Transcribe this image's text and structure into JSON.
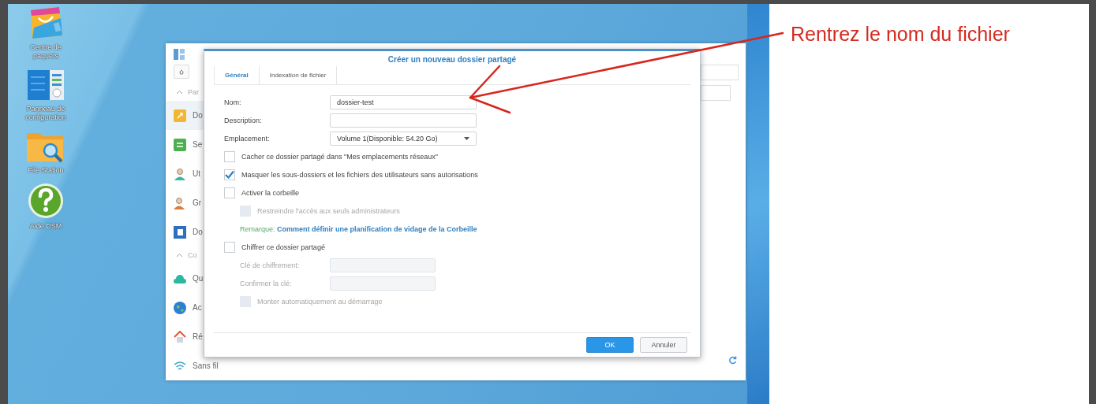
{
  "desktop_icons": [
    {
      "label": "Centre de paquets",
      "kind": "bag"
    },
    {
      "label": "Panneau de configuration",
      "kind": "panel"
    },
    {
      "label": "File Station",
      "kind": "folder"
    },
    {
      "label": "Aide DSM",
      "kind": "help"
    }
  ],
  "background_window": {
    "sidebar_items": [
      {
        "label": "Par",
        "kind": "section",
        "selected": false
      },
      {
        "label": "Do",
        "kind": "share",
        "selected": true
      },
      {
        "label": "Se",
        "kind": "sync",
        "selected": false
      },
      {
        "label": "Ut",
        "kind": "user",
        "selected": false
      },
      {
        "label": "Gr",
        "kind": "group",
        "selected": false
      },
      {
        "label": "Do",
        "kind": "domain",
        "selected": false
      },
      {
        "label": "Co",
        "kind": "section",
        "selected": false
      },
      {
        "label": "Qu",
        "kind": "cloud",
        "selected": false
      },
      {
        "label": "Ac",
        "kind": "globe",
        "selected": false
      },
      {
        "label": "Ré",
        "kind": "house",
        "selected": false
      },
      {
        "label": "Sans fil",
        "kind": "wifi",
        "selected": false
      }
    ]
  },
  "dialog": {
    "title": "Créer un nouveau dossier partagé",
    "tabs": [
      {
        "label": "Général",
        "selected": true
      },
      {
        "label": "Indexation de fichier",
        "selected": false
      }
    ],
    "rows": [
      {
        "kind": "field",
        "label": "Nom:",
        "value": "dossier-test",
        "disabled": false
      },
      {
        "kind": "field",
        "label": "Description:",
        "disabled": false
      },
      {
        "kind": "select",
        "label": "Emplacement:",
        "value": "Volume 1(Disponible: 54.20 Go)"
      },
      {
        "kind": "checkbox",
        "label": "Cacher ce dossier partagé dans \"Mes emplacements réseaux\"",
        "checked": false,
        "disabled": false
      },
      {
        "kind": "checkbox",
        "label": "Masquer les sous-dossiers et les fichiers des utilisateurs sans autorisations",
        "checked": true,
        "disabled": false
      },
      {
        "kind": "checkbox",
        "label": "Activer la corbeille",
        "checked": false,
        "disabled": false,
        "children": [
          {
            "kind": "checkbox",
            "label": "Restreindre l'accès aux seuls administrateurs",
            "checked": false,
            "disabled": true
          },
          {
            "kind": "remark",
            "label": "Remarque:",
            "link": "Comment définir une planification de vidage de la Corbeille"
          }
        ]
      },
      {
        "kind": "checkbox",
        "label": "Chiffrer ce dossier partagé",
        "checked": false,
        "disabled": false,
        "children": [
          {
            "kind": "field",
            "label": "Clé de chiffrement:",
            "disabled": true
          },
          {
            "kind": "field",
            "label": "Confirmer la clé:",
            "disabled": true
          },
          {
            "kind": "checkbox",
            "label": "Monter automatiquement au démarrage",
            "checked": false,
            "disabled": true
          }
        ]
      }
    ],
    "buttons": [
      {
        "label": "OK",
        "kind": "primary"
      },
      {
        "label": "Annuler",
        "kind": "secondary"
      }
    ]
  },
  "annotation": {
    "text": "Rentrez le nom du fichier"
  }
}
